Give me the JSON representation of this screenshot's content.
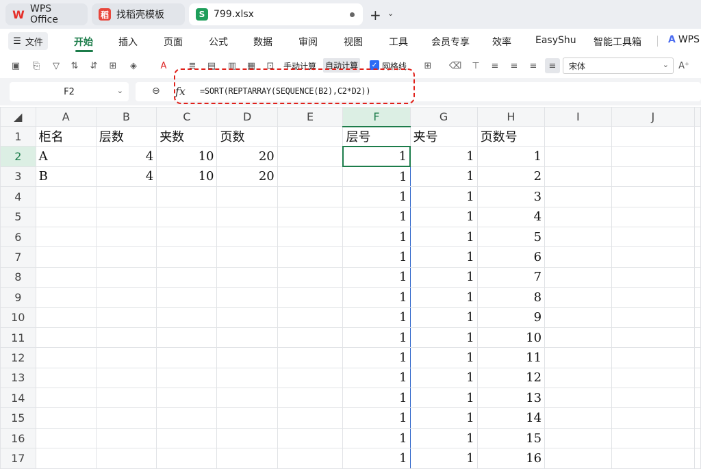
{
  "tabs": {
    "wps": "WPS Office",
    "template": "找稻壳模板",
    "file": "799.xlsx"
  },
  "menu": {
    "file": "文件",
    "items": [
      "开始",
      "插入",
      "页面",
      "公式",
      "数据",
      "审阅",
      "视图",
      "工具",
      "会员专享",
      "效率",
      "EasyShu",
      "智能工具箱"
    ],
    "wps_ai": "WPS"
  },
  "toolbar": {
    "manual_calc": "手动计算",
    "auto_calc": "自动计算",
    "gridlines": "网格线",
    "font": "宋体"
  },
  "formula_bar": {
    "name_box": "F2",
    "formula": "=SORT(REPTARRAY(SEQUENCE(B2),C2*D2))"
  },
  "columns": [
    "A",
    "B",
    "C",
    "D",
    "E",
    "F",
    "G",
    "H",
    "I",
    "J"
  ],
  "rows": [
    {
      "n": "1",
      "cells": [
        "柜名",
        "层数",
        "夹数",
        "页数",
        "",
        "层号",
        "夹号",
        "页数号",
        "",
        ""
      ]
    },
    {
      "n": "2",
      "cells": [
        "A",
        "4",
        "10",
        "20",
        "",
        "1",
        "1",
        "1",
        "",
        ""
      ]
    },
    {
      "n": "3",
      "cells": [
        "B",
        "4",
        "10",
        "20",
        "",
        "1",
        "1",
        "2",
        "",
        ""
      ]
    },
    {
      "n": "4",
      "cells": [
        "",
        "",
        "",
        "",
        "",
        "1",
        "1",
        "3",
        "",
        ""
      ]
    },
    {
      "n": "5",
      "cells": [
        "",
        "",
        "",
        "",
        "",
        "1",
        "1",
        "4",
        "",
        ""
      ]
    },
    {
      "n": "6",
      "cells": [
        "",
        "",
        "",
        "",
        "",
        "1",
        "1",
        "5",
        "",
        ""
      ]
    },
    {
      "n": "7",
      "cells": [
        "",
        "",
        "",
        "",
        "",
        "1",
        "1",
        "6",
        "",
        ""
      ]
    },
    {
      "n": "8",
      "cells": [
        "",
        "",
        "",
        "",
        "",
        "1",
        "1",
        "7",
        "",
        ""
      ]
    },
    {
      "n": "9",
      "cells": [
        "",
        "",
        "",
        "",
        "",
        "1",
        "1",
        "8",
        "",
        ""
      ]
    },
    {
      "n": "10",
      "cells": [
        "",
        "",
        "",
        "",
        "",
        "1",
        "1",
        "9",
        "",
        ""
      ]
    },
    {
      "n": "11",
      "cells": [
        "",
        "",
        "",
        "",
        "",
        "1",
        "1",
        "10",
        "",
        ""
      ]
    },
    {
      "n": "12",
      "cells": [
        "",
        "",
        "",
        "",
        "",
        "1",
        "1",
        "11",
        "",
        ""
      ]
    },
    {
      "n": "13",
      "cells": [
        "",
        "",
        "",
        "",
        "",
        "1",
        "1",
        "12",
        "",
        ""
      ]
    },
    {
      "n": "14",
      "cells": [
        "",
        "",
        "",
        "",
        "",
        "1",
        "1",
        "13",
        "",
        ""
      ]
    },
    {
      "n": "15",
      "cells": [
        "",
        "",
        "",
        "",
        "",
        "1",
        "1",
        "14",
        "",
        ""
      ]
    },
    {
      "n": "16",
      "cells": [
        "",
        "",
        "",
        "",
        "",
        "1",
        "1",
        "15",
        "",
        ""
      ]
    },
    {
      "n": "17",
      "cells": [
        "",
        "",
        "",
        "",
        "",
        "1",
        "1",
        "16",
        "",
        ""
      ]
    }
  ],
  "selection": {
    "cell": "F2"
  },
  "colors": {
    "accent": "#1c7c4a",
    "highlight": "#e0201a"
  }
}
